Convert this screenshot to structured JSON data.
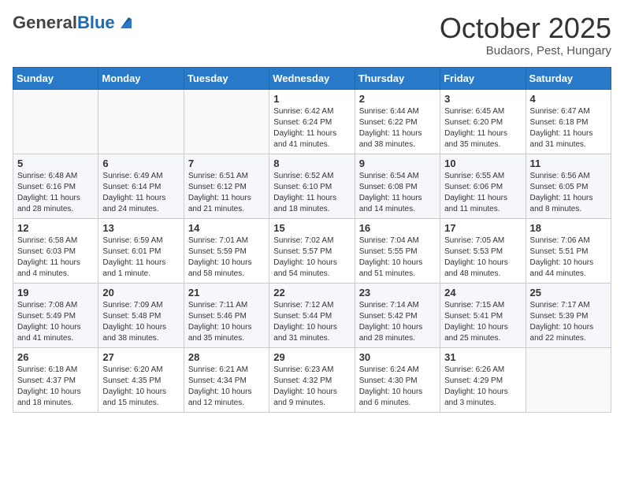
{
  "header": {
    "logo_general": "General",
    "logo_blue": "Blue",
    "month": "October 2025",
    "location": "Budaors, Pest, Hungary"
  },
  "weekdays": [
    "Sunday",
    "Monday",
    "Tuesday",
    "Wednesday",
    "Thursday",
    "Friday",
    "Saturday"
  ],
  "weeks": [
    [
      {
        "day": "",
        "info": ""
      },
      {
        "day": "",
        "info": ""
      },
      {
        "day": "",
        "info": ""
      },
      {
        "day": "1",
        "info": "Sunrise: 6:42 AM\nSunset: 6:24 PM\nDaylight: 11 hours\nand 41 minutes."
      },
      {
        "day": "2",
        "info": "Sunrise: 6:44 AM\nSunset: 6:22 PM\nDaylight: 11 hours\nand 38 minutes."
      },
      {
        "day": "3",
        "info": "Sunrise: 6:45 AM\nSunset: 6:20 PM\nDaylight: 11 hours\nand 35 minutes."
      },
      {
        "day": "4",
        "info": "Sunrise: 6:47 AM\nSunset: 6:18 PM\nDaylight: 11 hours\nand 31 minutes."
      }
    ],
    [
      {
        "day": "5",
        "info": "Sunrise: 6:48 AM\nSunset: 6:16 PM\nDaylight: 11 hours\nand 28 minutes."
      },
      {
        "day": "6",
        "info": "Sunrise: 6:49 AM\nSunset: 6:14 PM\nDaylight: 11 hours\nand 24 minutes."
      },
      {
        "day": "7",
        "info": "Sunrise: 6:51 AM\nSunset: 6:12 PM\nDaylight: 11 hours\nand 21 minutes."
      },
      {
        "day": "8",
        "info": "Sunrise: 6:52 AM\nSunset: 6:10 PM\nDaylight: 11 hours\nand 18 minutes."
      },
      {
        "day": "9",
        "info": "Sunrise: 6:54 AM\nSunset: 6:08 PM\nDaylight: 11 hours\nand 14 minutes."
      },
      {
        "day": "10",
        "info": "Sunrise: 6:55 AM\nSunset: 6:06 PM\nDaylight: 11 hours\nand 11 minutes."
      },
      {
        "day": "11",
        "info": "Sunrise: 6:56 AM\nSunset: 6:05 PM\nDaylight: 11 hours\nand 8 minutes."
      }
    ],
    [
      {
        "day": "12",
        "info": "Sunrise: 6:58 AM\nSunset: 6:03 PM\nDaylight: 11 hours\nand 4 minutes."
      },
      {
        "day": "13",
        "info": "Sunrise: 6:59 AM\nSunset: 6:01 PM\nDaylight: 11 hours\nand 1 minute."
      },
      {
        "day": "14",
        "info": "Sunrise: 7:01 AM\nSunset: 5:59 PM\nDaylight: 10 hours\nand 58 minutes."
      },
      {
        "day": "15",
        "info": "Sunrise: 7:02 AM\nSunset: 5:57 PM\nDaylight: 10 hours\nand 54 minutes."
      },
      {
        "day": "16",
        "info": "Sunrise: 7:04 AM\nSunset: 5:55 PM\nDaylight: 10 hours\nand 51 minutes."
      },
      {
        "day": "17",
        "info": "Sunrise: 7:05 AM\nSunset: 5:53 PM\nDaylight: 10 hours\nand 48 minutes."
      },
      {
        "day": "18",
        "info": "Sunrise: 7:06 AM\nSunset: 5:51 PM\nDaylight: 10 hours\nand 44 minutes."
      }
    ],
    [
      {
        "day": "19",
        "info": "Sunrise: 7:08 AM\nSunset: 5:49 PM\nDaylight: 10 hours\nand 41 minutes."
      },
      {
        "day": "20",
        "info": "Sunrise: 7:09 AM\nSunset: 5:48 PM\nDaylight: 10 hours\nand 38 minutes."
      },
      {
        "day": "21",
        "info": "Sunrise: 7:11 AM\nSunset: 5:46 PM\nDaylight: 10 hours\nand 35 minutes."
      },
      {
        "day": "22",
        "info": "Sunrise: 7:12 AM\nSunset: 5:44 PM\nDaylight: 10 hours\nand 31 minutes."
      },
      {
        "day": "23",
        "info": "Sunrise: 7:14 AM\nSunset: 5:42 PM\nDaylight: 10 hours\nand 28 minutes."
      },
      {
        "day": "24",
        "info": "Sunrise: 7:15 AM\nSunset: 5:41 PM\nDaylight: 10 hours\nand 25 minutes."
      },
      {
        "day": "25",
        "info": "Sunrise: 7:17 AM\nSunset: 5:39 PM\nDaylight: 10 hours\nand 22 minutes."
      }
    ],
    [
      {
        "day": "26",
        "info": "Sunrise: 6:18 AM\nSunset: 4:37 PM\nDaylight: 10 hours\nand 18 minutes."
      },
      {
        "day": "27",
        "info": "Sunrise: 6:20 AM\nSunset: 4:35 PM\nDaylight: 10 hours\nand 15 minutes."
      },
      {
        "day": "28",
        "info": "Sunrise: 6:21 AM\nSunset: 4:34 PM\nDaylight: 10 hours\nand 12 minutes."
      },
      {
        "day": "29",
        "info": "Sunrise: 6:23 AM\nSunset: 4:32 PM\nDaylight: 10 hours\nand 9 minutes."
      },
      {
        "day": "30",
        "info": "Sunrise: 6:24 AM\nSunset: 4:30 PM\nDaylight: 10 hours\nand 6 minutes."
      },
      {
        "day": "31",
        "info": "Sunrise: 6:26 AM\nSunset: 4:29 PM\nDaylight: 10 hours\nand 3 minutes."
      },
      {
        "day": "",
        "info": ""
      }
    ]
  ]
}
